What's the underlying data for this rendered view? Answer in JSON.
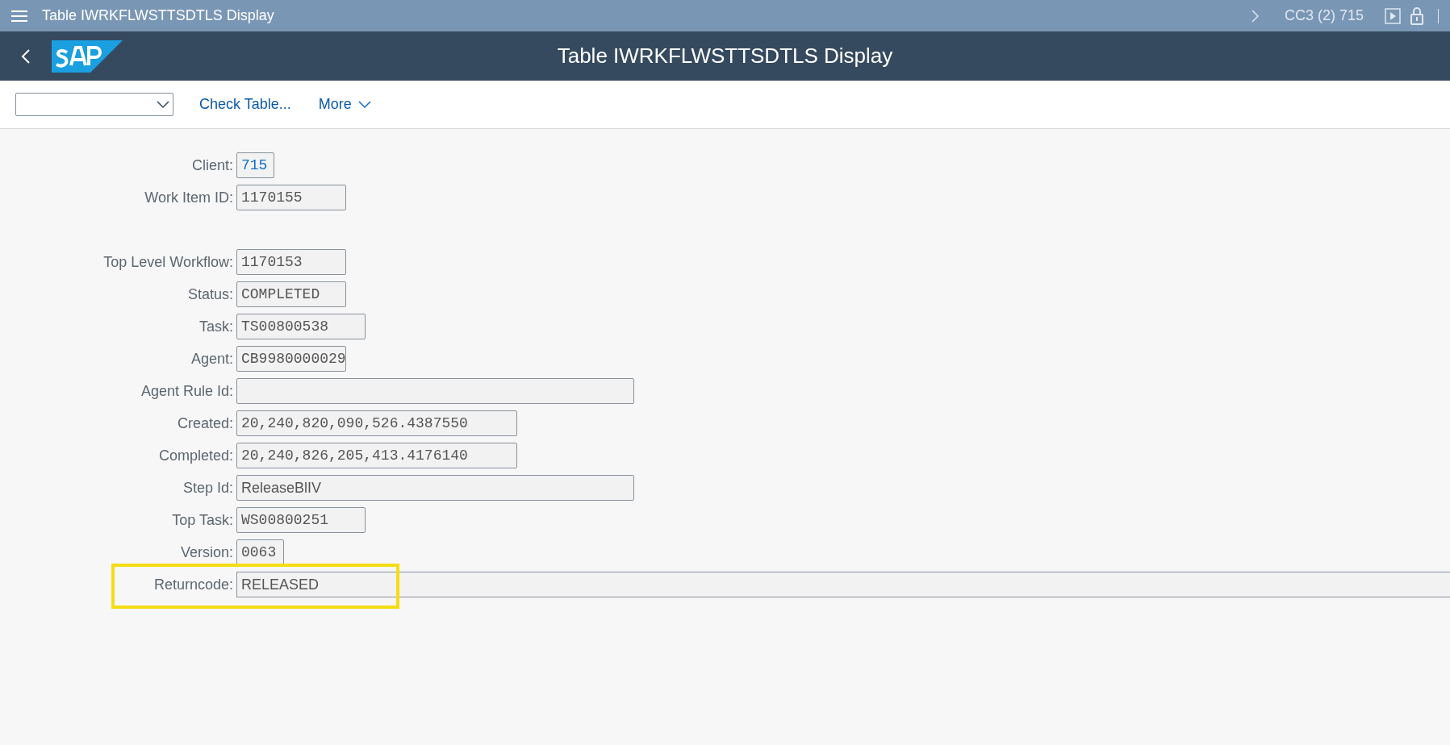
{
  "shell_bar": {
    "title": "Table IWRKFLWSTTSDTLS Display",
    "system": "CC3 (2) 715"
  },
  "header": {
    "title": "Table IWRKFLWSTTSDTLS Display"
  },
  "toolbar": {
    "buttons": [
      "Check Table...",
      "More"
    ]
  },
  "key_fields": [
    {
      "label": "Client:",
      "value": "715",
      "kind": "link",
      "highlighted": false
    },
    {
      "label": "Work Item ID:",
      "value": "1170155",
      "kind": "mono",
      "highlighted": false
    }
  ],
  "fields": [
    {
      "label": "Top Level Workflow:",
      "value": "1170153",
      "kind": "mono",
      "highlighted": false
    },
    {
      "label": "Status:",
      "value": "COMPLETED",
      "kind": "mono",
      "highlighted": false
    },
    {
      "label": "Task:",
      "value": "TS00800538",
      "kind": "mono",
      "highlighted": false
    },
    {
      "label": "Agent:",
      "value": "CB9980000029",
      "kind": "mono",
      "highlighted": false
    },
    {
      "label": "Agent Rule Id:",
      "kind": "text",
      "highlighted": false
    },
    {
      "label": "Created:",
      "value": "20,240,820,090,526.4387550",
      "kind": "mono",
      "highlighted": false
    },
    {
      "label": "Completed:",
      "value": "20,240,826,205,413.4176140",
      "kind": "mono",
      "highlighted": false
    },
    {
      "label": "Step Id:",
      "value": "ReleaseBlIV",
      "kind": "text",
      "highlighted": false
    },
    {
      "label": "Top Task:",
      "value": "WS00800251",
      "kind": "mono",
      "highlighted": false
    },
    {
      "label": "Version:",
      "value": "0063",
      "kind": "mono",
      "highlighted": false
    },
    {
      "label": "Returncode:",
      "value": "RELEASED",
      "kind": "text",
      "highlighted": true
    }
  ]
}
